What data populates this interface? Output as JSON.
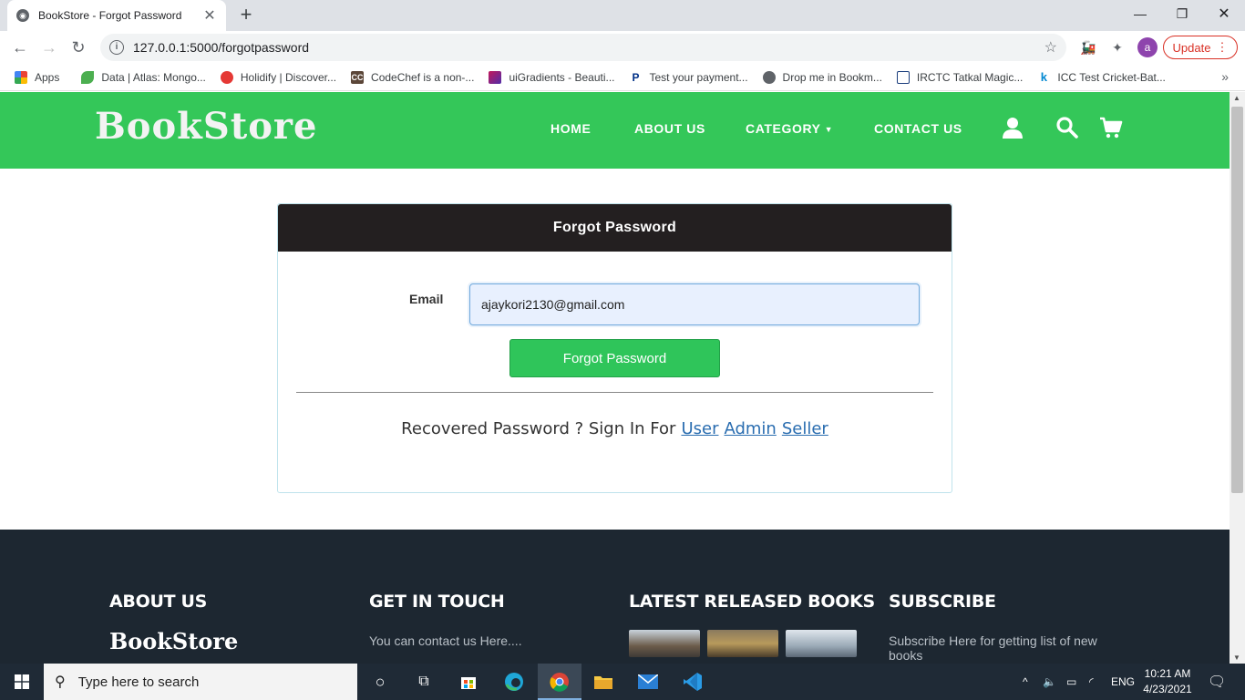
{
  "browser": {
    "tab_title": "BookStore - Forgot Password",
    "url": "127.0.0.1:5000/forgotpassword",
    "profile_initial": "a",
    "update_label": "Update",
    "apps_label": "Apps",
    "bookmarks": [
      {
        "label": "Data | Atlas: Mongo...",
        "icon": "leaf-icon",
        "color": "#4caf50"
      },
      {
        "label": "Holidify | Discover...",
        "icon": "holidify-icon",
        "color": "#e53935"
      },
      {
        "label": "CodeChef is a non-...",
        "icon": "codechef-icon",
        "color": "#5b4638"
      },
      {
        "label": "uiGradients - Beauti...",
        "icon": "gradient-icon",
        "color": "#c2185b"
      },
      {
        "label": "Test your payment...",
        "icon": "paypal-icon",
        "color": "#003087"
      },
      {
        "label": "Drop me in Bookm...",
        "icon": "globe-icon",
        "color": "#5f6368"
      },
      {
        "label": "IRCTC Tatkal Magic...",
        "icon": "irctc-icon",
        "color": "#1a3d7c"
      },
      {
        "label": "ICC Test Cricket-Bat...",
        "icon": "k-icon",
        "color": "#0288d1"
      }
    ]
  },
  "site": {
    "logo": "BookStore",
    "nav": {
      "home": "HOME",
      "about": "ABOUT US",
      "category": "CATEGORY",
      "contact": "CONTACT US"
    },
    "accent_color": "#34c759"
  },
  "form": {
    "heading": "Forgot Password",
    "email_label": "Email",
    "email_value": "ajaykori2130@gmail.com",
    "submit_label": "Forgot Password",
    "recover_text": "Recovered Password ? Sign In For",
    "links": {
      "user": "User",
      "admin": "Admin",
      "seller": "Seller"
    }
  },
  "footer": {
    "about_heading": "ABOUT US",
    "about_logo": "BookStore",
    "contact_heading": "GET IN TOUCH",
    "contact_text": "You can contact us Here....",
    "latest_heading": "LATEST RELEASED BOOKS",
    "subscribe_heading": "SUBSCRIBE",
    "subscribe_text": "Subscribe Here for getting list of new books"
  },
  "taskbar": {
    "search_placeholder": "Type here to search",
    "language": "ENG",
    "time": "10:21 AM",
    "date": "4/23/2021"
  }
}
